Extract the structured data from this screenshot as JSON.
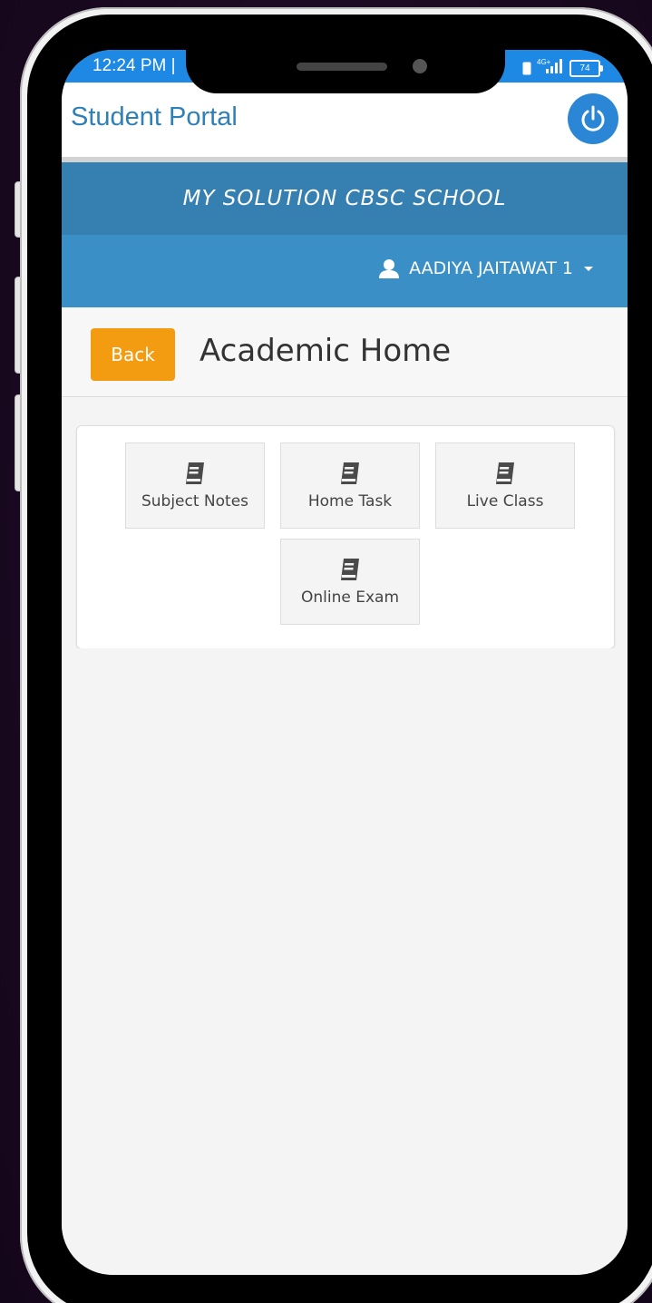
{
  "status_bar": {
    "time": "12:24 PM |",
    "network": "4G+",
    "battery": "74"
  },
  "app_bar": {
    "title": "Student Portal",
    "power_icon": "power-icon"
  },
  "school": {
    "name": "MY SOLUTION CBSC SCHOOL"
  },
  "user": {
    "name": "AADIYA JAITAWAT 1",
    "icon": "user-icon"
  },
  "page": {
    "back_label": "Back",
    "title": "Academic Home"
  },
  "tiles": [
    {
      "label": "Subject Notes",
      "icon": "book-icon"
    },
    {
      "label": "Home Task",
      "icon": "book-icon"
    },
    {
      "label": "Live Class",
      "icon": "book-icon"
    },
    {
      "label": "Online Exam",
      "icon": "book-icon"
    }
  ],
  "colors": {
    "status_bar": "#1e88e5",
    "app_title": "#2f80b8",
    "banner": "#357fb1",
    "user_bar": "#3a8fc7",
    "back_button": "#f39c12",
    "background": "#1c0a22"
  }
}
